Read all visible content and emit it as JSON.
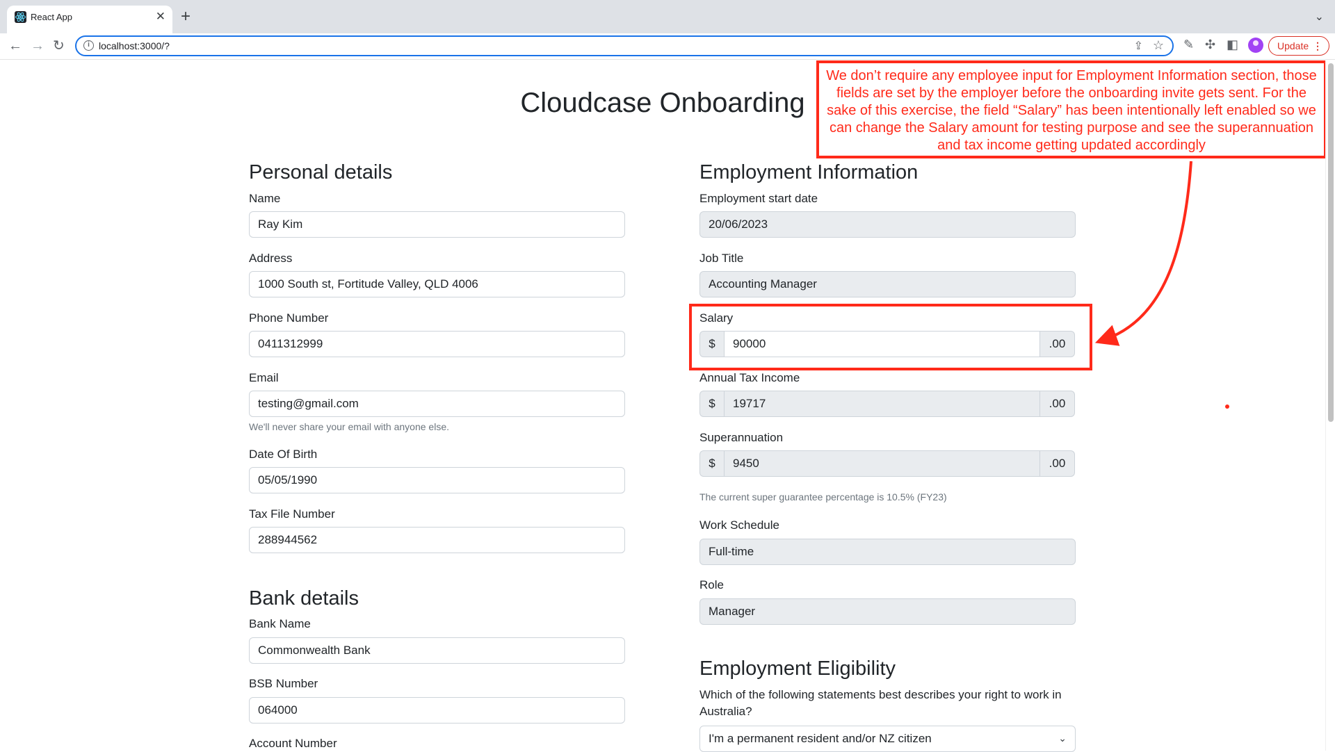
{
  "browser": {
    "tab_title": "React App",
    "tab_close": "✕",
    "new_tab": "+",
    "tabs_menu": "⌄",
    "back": "←",
    "forward": "→",
    "reload": "↻",
    "url": "localhost:3000/?",
    "update_label": "Update",
    "update_menu": "⋮"
  },
  "page": {
    "title": "Cloudcase Onboarding"
  },
  "personal": {
    "heading": "Personal details",
    "name_label": "Name",
    "name_value": "Ray Kim",
    "address_label": "Address",
    "address_value": "1000 South st, Fortitude Valley, QLD 4006",
    "phone_label": "Phone Number",
    "phone_value": "0411312999",
    "email_label": "Email",
    "email_value": "testing@gmail.com",
    "email_hint": "We'll never share your email with anyone else.",
    "dob_label": "Date Of Birth",
    "dob_value": "05/05/1990",
    "tfn_label": "Tax File Number",
    "tfn_value": "288944562"
  },
  "bank": {
    "heading": "Bank details",
    "bank_name_label": "Bank Name",
    "bank_name_value": "Commonwealth Bank",
    "bsb_label": "BSB Number",
    "bsb_value": "064000",
    "account_label": "Account Number"
  },
  "employment": {
    "heading": "Employment Information",
    "start_date_label": "Employment start date",
    "start_date_value": "20/06/2023",
    "job_title_label": "Job Title",
    "job_title_value": "Accounting Manager",
    "salary_label": "Salary",
    "currency_prefix": "$",
    "cents_suffix": ".00",
    "salary_value": "90000",
    "tax_label": "Annual Tax Income",
    "tax_value": "19717",
    "super_label": "Superannuation",
    "super_value": "9450",
    "super_hint": "The current super guarantee percentage is 10.5% (FY23)",
    "schedule_label": "Work Schedule",
    "schedule_value": "Full-time",
    "role_label": "Role",
    "role_value": "Manager"
  },
  "eligibility": {
    "heading": "Employment Eligibility",
    "question": "Which of the following statements best describes your right to work in Australia?",
    "selected": "I'm a permanent resident and/or NZ citizen"
  },
  "annotation": {
    "text": "We don’t require any employee input for Employment Information section, those fields are set by the employer before the onboarding invite gets sent. For the sake of this exercise, the field “Salary” has been intentionally left enabled so we can change the Salary amount for testing purpose and see the superannuation and tax income getting updated accordingly",
    "color": "#ff2a1a"
  },
  "colors": {
    "accent": "#1a73e8",
    "disabled_bg": "#e9ecef",
    "border": "#ced4da"
  }
}
